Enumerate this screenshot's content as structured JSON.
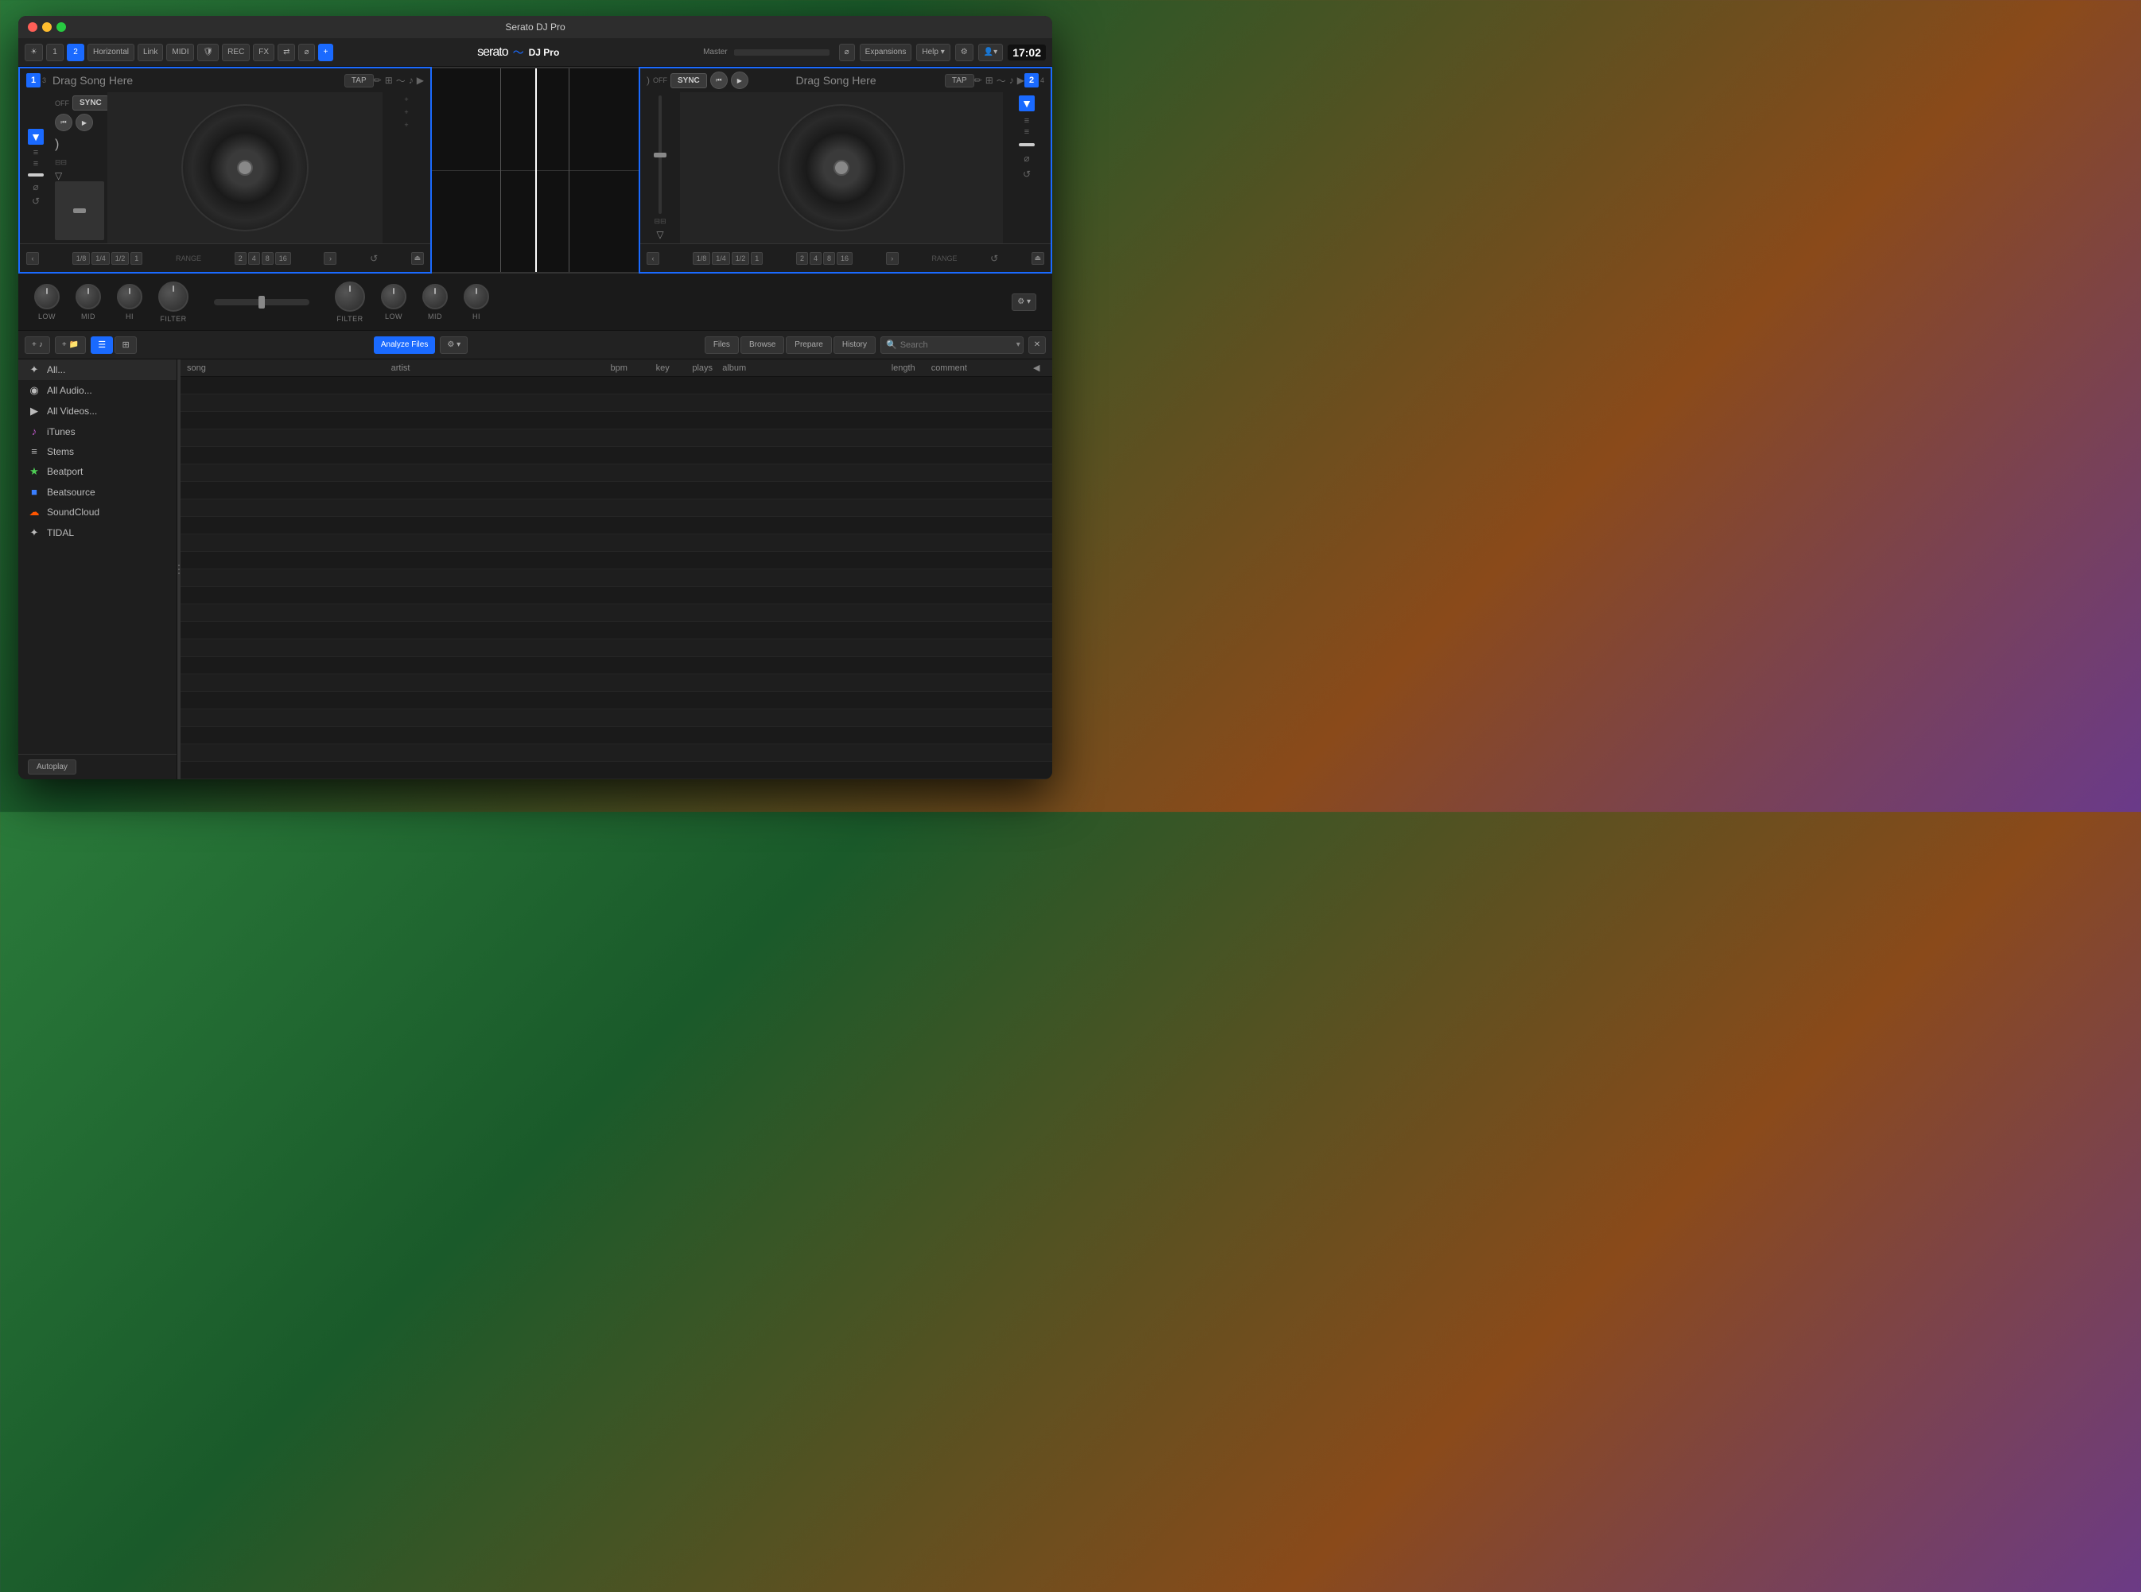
{
  "app": {
    "title": "Serato DJ Pro",
    "time": "17:02"
  },
  "titlebar": {
    "close": "×",
    "minimize": "−",
    "maximize": "+"
  },
  "toolbar": {
    "btn1": "1",
    "btn2": "2",
    "layout": "Horizontal",
    "link": "Link",
    "midi": "MIDI",
    "shield": "🛡",
    "rec": "REC",
    "fx": "FX",
    "swap": "⇄",
    "headphones": "🎧",
    "plus": "+",
    "master": "Master",
    "expansions": "Expansions",
    "help": "Help",
    "gear": "⚙",
    "user": "👤"
  },
  "deck1": {
    "number": "1",
    "sub_number": "3",
    "placeholder": "Drag Song Here",
    "tap": "TAP",
    "sync_off": "OFF",
    "sync": "SYNC",
    "range": "RANGE",
    "beat_sizes": [
      "1/8",
      "1/4",
      "1/2",
      "1"
    ],
    "beat_sizes2": [
      "2",
      "4",
      "8",
      "16"
    ]
  },
  "deck2": {
    "number": "2",
    "sub_number": "4",
    "placeholder": "Drag Song Here",
    "tap": "TAP",
    "sync_off": "OFF",
    "sync": "SYNC",
    "range": "RANGE",
    "beat_sizes": [
      "1/8",
      "1/4",
      "1/2",
      "1"
    ],
    "beat_sizes2": [
      "2",
      "4",
      "8",
      "16"
    ]
  },
  "mixer": {
    "left": {
      "low": "LOW",
      "mid": "MID",
      "hi": "HI",
      "filter": "FILTER"
    },
    "right": {
      "filter": "FILTER",
      "low": "LOW",
      "mid": "MID",
      "hi": "HI"
    }
  },
  "library": {
    "analyze_files": "Analyze Files",
    "panel_files": "Files",
    "panel_browse": "Browse",
    "panel_prepare": "Prepare",
    "panel_history": "History",
    "search_placeholder": "Search",
    "autoplay": "Autoplay",
    "columns": {
      "song": "song",
      "artist": "artist",
      "bpm": "bpm",
      "key": "key",
      "plays": "plays",
      "album": "album",
      "length": "length",
      "comment": "comment"
    }
  },
  "sidebar": {
    "items": [
      {
        "icon": "✦",
        "label": "All...",
        "active": true
      },
      {
        "icon": "◉",
        "label": "All Audio..."
      },
      {
        "icon": "▶",
        "label": "All Videos..."
      },
      {
        "icon": "♪",
        "label": "iTunes"
      },
      {
        "icon": "≡",
        "label": "Stems"
      },
      {
        "icon": "★",
        "label": "Beatport"
      },
      {
        "icon": "■",
        "label": "Beatsource"
      },
      {
        "icon": "☁",
        "label": "SoundCloud"
      },
      {
        "icon": "✦",
        "label": "TIDAL"
      }
    ]
  },
  "serato": {
    "logo_text": "serato",
    "wave_icon": "〜",
    "dj_pro": "DJ Pro"
  }
}
